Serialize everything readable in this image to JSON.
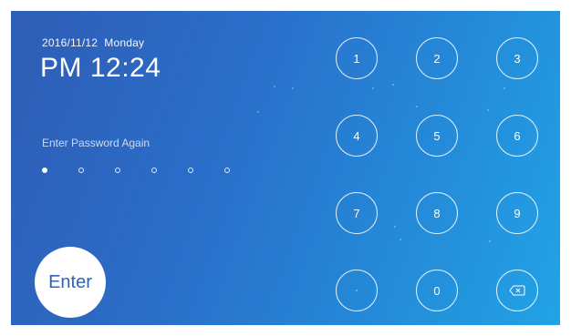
{
  "status": {
    "date": "2016/11/12",
    "weekday": "Monday",
    "time": "PM 12:24"
  },
  "password": {
    "prompt": "Enter Password Again",
    "length": 6,
    "entered": 1
  },
  "enter_button": {
    "label": "Enter"
  },
  "keypad": {
    "keys": [
      "1",
      "2",
      "3",
      "4",
      "5",
      "6",
      "7",
      "8",
      "9",
      "·",
      "0"
    ],
    "backspace_icon": "backspace-icon"
  },
  "colors": {
    "background_start": "#2f5db5",
    "background_end": "#22a3e6",
    "enter_text": "#2f63b8"
  }
}
